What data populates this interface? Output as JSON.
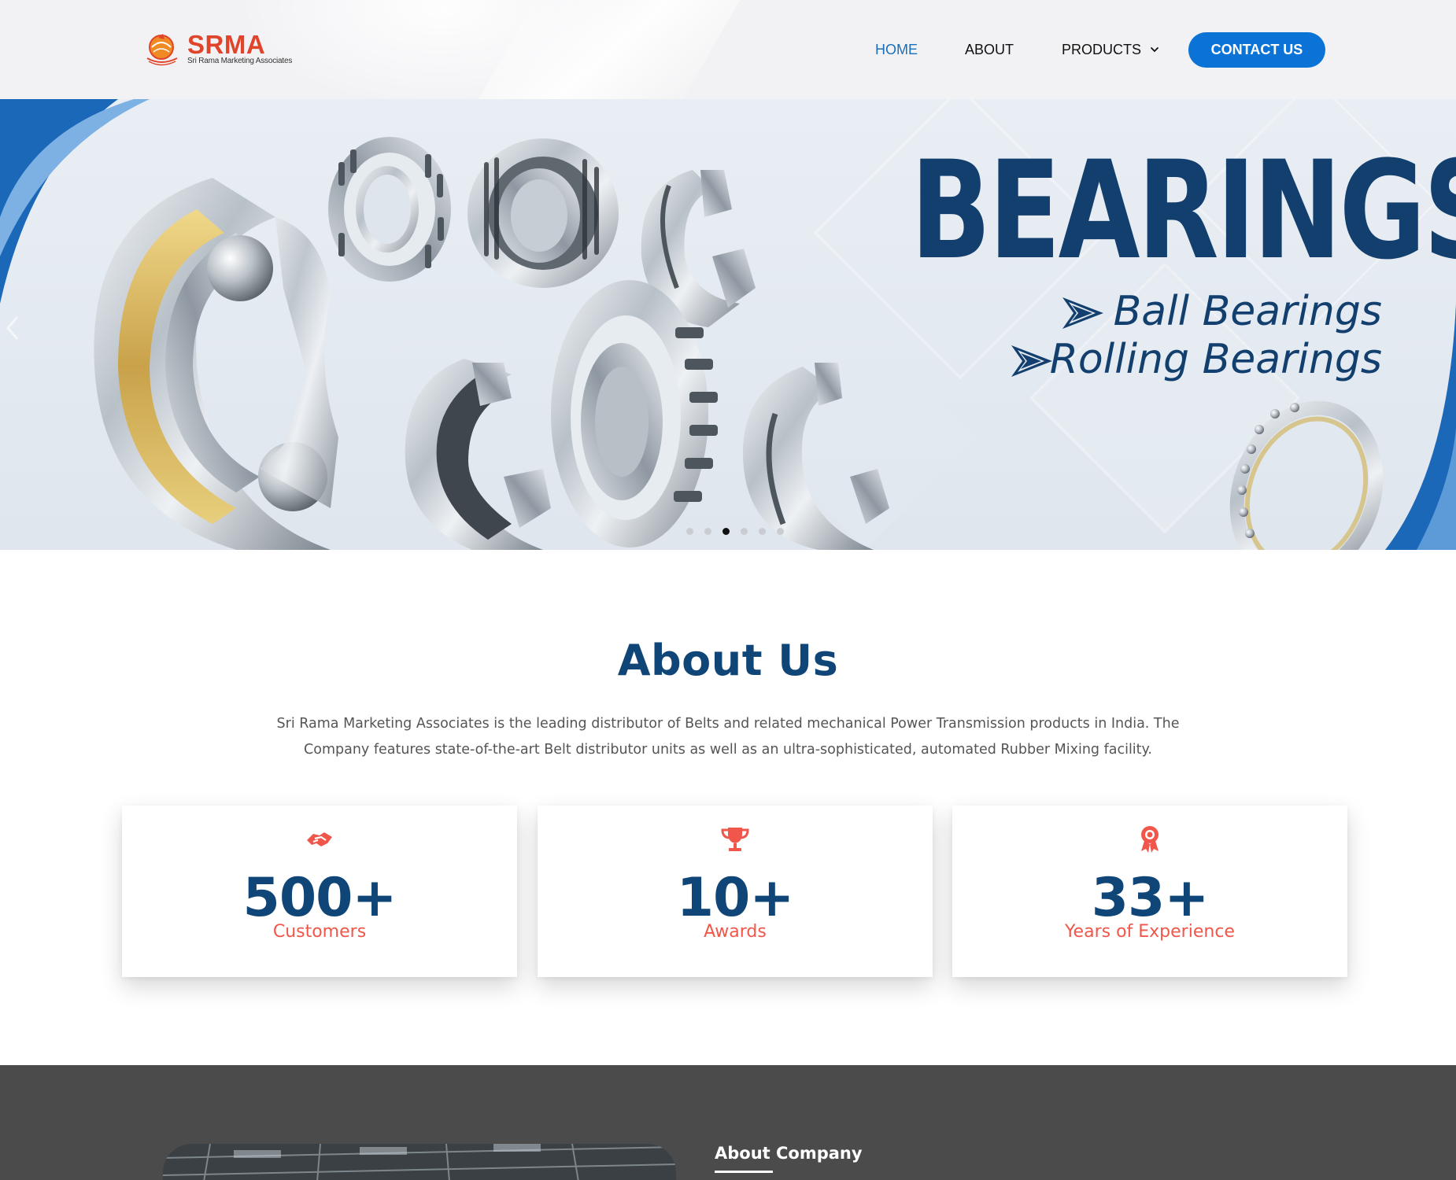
{
  "brand": {
    "logo_text": "SRMA",
    "logo_tagline": "Sri Rama Marketing Associates",
    "accent_color": "#e0452b"
  },
  "nav": {
    "items": [
      {
        "label": "HOME",
        "active": true
      },
      {
        "label": "ABOUT",
        "active": false
      },
      {
        "label": "PRODUCTS",
        "active": false,
        "icon": "chevron-down-icon"
      }
    ],
    "cta_label": "CONTACT US",
    "cta_color": "#0b73d6"
  },
  "hero": {
    "title": "BEARINGS",
    "subtitles": [
      "Ball Bearings",
      "Rolling Bearings"
    ],
    "slide_count": 6,
    "active_slide": 3,
    "title_color": "#123f6e"
  },
  "about": {
    "title": "About Us",
    "text": "Sri Rama Marketing Associates is the leading distributor of Belts and related mechanical Power Transmission products in India. The Company features state-of-the-art Belt distributor units as well as an ultra-sophisticated, automated Rubber Mixing facility.",
    "stats": [
      {
        "value": "500+",
        "label": "Customers",
        "icon": "handshake-icon"
      },
      {
        "value": "10+",
        "label": "Awards",
        "icon": "trophy-icon"
      },
      {
        "value": "33+",
        "label": "Years of Experience",
        "icon": "award-ribbon-icon"
      }
    ],
    "stat_label_color": "#f0574a",
    "stat_number_color": "#0f4577"
  },
  "company": {
    "heading": "About Company"
  }
}
